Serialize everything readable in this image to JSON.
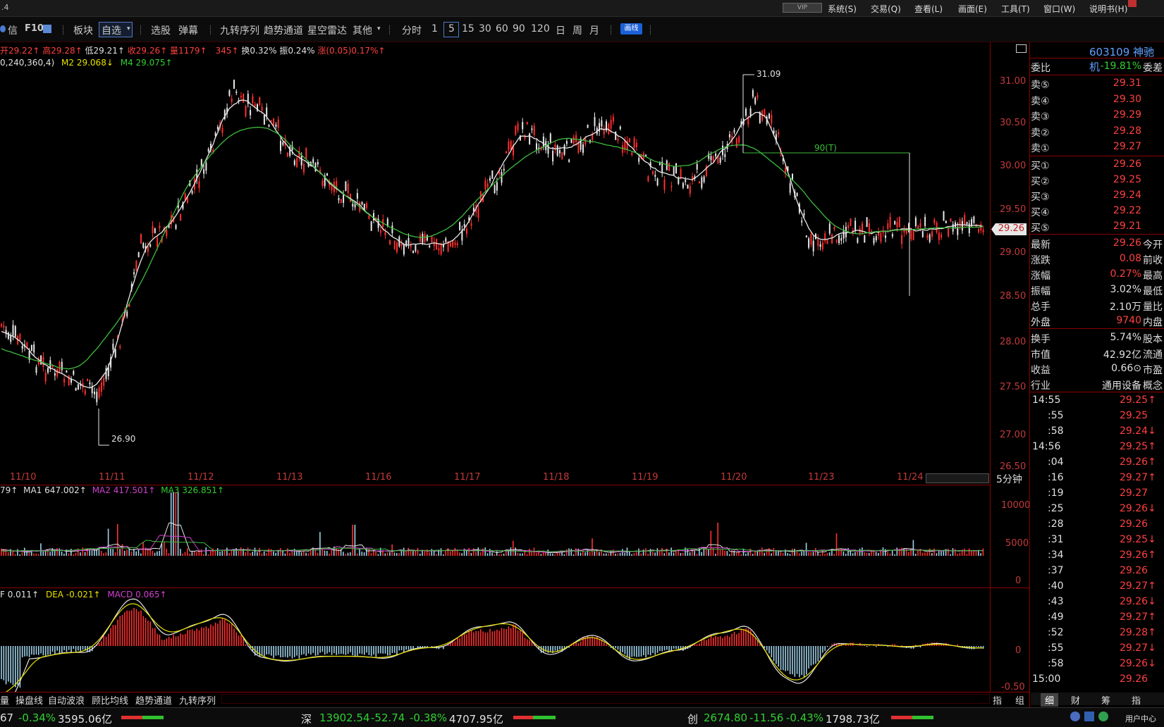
{
  "window": {
    "title_fragment": ".4",
    "vip": "VIP",
    "menu": [
      "系统(S)",
      "交易(Q)",
      "查看(L)",
      "画面(E)",
      "工具(T)",
      "窗口(W)",
      "说明书(H)"
    ]
  },
  "toolbar": {
    "items": [
      "信",
      "F10",
      "板块",
      "自选",
      "选股",
      "弹幕",
      "九转序列",
      "趋势通道",
      "星空雷达",
      "其他"
    ],
    "periods": [
      "分时",
      "1",
      "5",
      "15",
      "30",
      "60",
      "90",
      "120",
      "日",
      "周",
      "月"
    ],
    "draw_label": "画线"
  },
  "price_header": {
    "open": "开29.22↑",
    "high": "高29.28↑",
    "low": "低29.21↑",
    "close": "收29.26↑",
    "volume": "量1179↑",
    "amount": "345↑",
    "turnover": "换0.32%",
    "amplitude": "振0.24%",
    "change": "涨(0.05)0.17%↑"
  },
  "ma_header": {
    "params": "0,240,360,4)",
    "m2": "M2 29.068↓",
    "m4": "M4 29.075↑"
  },
  "price_axis": [
    "31.00",
    "30.50",
    "30.00",
    "29.50",
    "29.00",
    "28.50",
    "28.00",
    "27.50",
    "27.00",
    "26.50"
  ],
  "current_price_tag": "29.26",
  "annotations": {
    "high": "31.09",
    "low": "26.90",
    "line_label": "90(T)"
  },
  "dates": [
    "11/10",
    "11/11",
    "11/12",
    "11/13",
    "11/16",
    "11/17",
    "11/18",
    "11/19",
    "11/20",
    "11/23",
    "11/24"
  ],
  "period_label": "5分钟",
  "volume_header": {
    "v": "79↑",
    "ma1": "MA1 647.002↑",
    "ma2": "MA2 417.501↑",
    "ma3": "MA3 326.851↑"
  },
  "volume_axis": [
    "10000",
    "5000",
    "0"
  ],
  "macd_header": {
    "dif": "F 0.011↑",
    "dea": "DEA -0.021↑",
    "macd": "MACD 0.065↑"
  },
  "macd_axis": [
    "0",
    "-0.50"
  ],
  "bottom_tabs": [
    "量",
    "操盘线",
    "自动波浪",
    "顾比均线",
    "趋势通道",
    "九转序列"
  ],
  "bottom_right": [
    "指",
    "组"
  ],
  "right_panel": {
    "code": "603109",
    "name": "神驰机",
    "weibi": {
      "label": "委比",
      "value": "-19.81%",
      "tail": "委差"
    },
    "sells": [
      {
        "label": "卖⑤",
        "price": "29.31"
      },
      {
        "label": "卖④",
        "price": "29.30"
      },
      {
        "label": "卖③",
        "price": "29.29"
      },
      {
        "label": "卖②",
        "price": "29.28"
      },
      {
        "label": "卖①",
        "price": "29.27"
      }
    ],
    "buys": [
      {
        "label": "买①",
        "price": "29.26"
      },
      {
        "label": "买②",
        "price": "29.25"
      },
      {
        "label": "买③",
        "price": "29.24"
      },
      {
        "label": "买④",
        "price": "29.22"
      },
      {
        "label": "买⑤",
        "price": "29.21"
      }
    ],
    "stats": [
      {
        "label": "最新",
        "value": "29.26",
        "tail": "今开"
      },
      {
        "label": "涨跌",
        "value": "0.08",
        "tail": "前收"
      },
      {
        "label": "涨幅",
        "value": "0.27%",
        "tail": "最高"
      },
      {
        "label": "振幅",
        "value": "3.02%",
        "tail": "最低"
      },
      {
        "label": "总手",
        "value": "2.10万",
        "tail": "量比"
      },
      {
        "label": "外盘",
        "value": "9740",
        "tail": "内盘"
      }
    ],
    "stats2": [
      {
        "label": "换手",
        "value": "5.74%",
        "tail": "股本"
      },
      {
        "label": "市值",
        "value": "42.92亿",
        "tail": "流通"
      },
      {
        "label": "收益",
        "value": "0.66⊙",
        "tail": "市盈"
      },
      {
        "label": "行业",
        "value": "通用设备",
        "tail": "概念"
      }
    ],
    "ticks": [
      {
        "t": "14:55",
        "p": "29.25↑"
      },
      {
        "t": ":55",
        "p": "29.25"
      },
      {
        "t": ":58",
        "p": "29.24↓"
      },
      {
        "t": "14:56",
        "p": "29.25↑"
      },
      {
        "t": ":04",
        "p": "29.26↑"
      },
      {
        "t": ":16",
        "p": "29.27↑"
      },
      {
        "t": ":19",
        "p": "29.27"
      },
      {
        "t": ":25",
        "p": "29.26↓"
      },
      {
        "t": ":28",
        "p": "29.26"
      },
      {
        "t": ":31",
        "p": "29.25↓"
      },
      {
        "t": ":34",
        "p": "29.26↑"
      },
      {
        "t": ":37",
        "p": "29.26"
      },
      {
        "t": ":40",
        "p": "29.27↑"
      },
      {
        "t": ":43",
        "p": "29.26↓"
      },
      {
        "t": ":49",
        "p": "29.27↑"
      },
      {
        "t": ":52",
        "p": "29.28↑"
      },
      {
        "t": ":55",
        "p": "29.27↓"
      },
      {
        "t": ":58",
        "p": "29.26↓"
      },
      {
        "t": "15:00",
        "p": "29.26"
      }
    ],
    "tabs": [
      "细",
      "财",
      "筹",
      "指"
    ]
  },
  "status": {
    "idx1": {
      "a": "67",
      "b": "-0.34%",
      "c": "3595.06亿"
    },
    "idx2": {
      "name": "深",
      "a": "13902.54",
      "b": "-52.74",
      "c": "-0.38%",
      "d": "4707.95亿"
    },
    "idx3": {
      "name": "创",
      "a": "2674.80",
      "b": "-11.56",
      "c": "-0.43%",
      "d": "1798.73亿"
    },
    "user": "用户中心"
  },
  "colors": {
    "up": "#ff4040",
    "down": "#30d030",
    "frame": "#8a0000",
    "ma_white": "#e8e8e8",
    "ma_green": "#3cbc3c"
  }
}
